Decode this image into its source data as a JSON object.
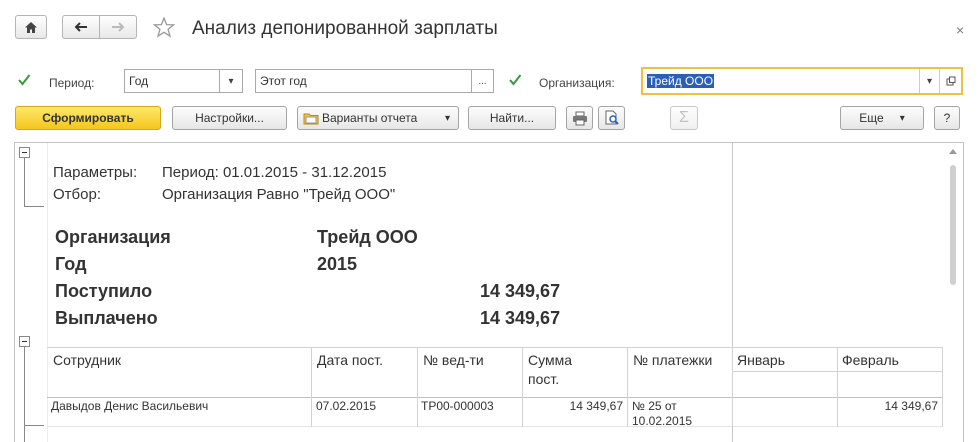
{
  "title": "Анализ депонированной зарплаты",
  "params": {
    "period_label": "Период:",
    "period_value": "Год",
    "period_range": "Этот год",
    "org_label": "Организация:",
    "org_value": "Трейд ООО"
  },
  "toolbar": {
    "generate": "Сформировать",
    "settings": "Настройки...",
    "variants": "Варианты отчета",
    "find": "Найти...",
    "more": "Еще",
    "help": "?"
  },
  "report": {
    "params_label": "Параметры:",
    "params_value": "Период: 01.01.2015 - 31.12.2015",
    "filter_label": "Отбор:",
    "filter_value": "Организация Равно \"Трейд ООО\"",
    "summary": {
      "org_label": "Организация",
      "org_value": "Трейд ООО",
      "year_label": "Год",
      "year_value": "2015",
      "received_label": "Поступило",
      "received_value": "14 349,67",
      "paid_label": "Выплачено",
      "paid_value": "14 349,67"
    },
    "columns": {
      "employee": "Сотрудник",
      "date": "Дата пост.",
      "sheet": "№ вед-ти",
      "sum_line1": "Сумма",
      "sum_line2": "пост.",
      "payment": "№ платежки",
      "jan": "Январь",
      "feb": "Февраль"
    },
    "row": {
      "employee": "Давыдов Денис Васильевич",
      "date": "07.02.2015",
      "sheet": "ТР00-000003",
      "sum": "14 349,67",
      "payment_line1": "№ 25 от",
      "payment_line2": "10.02.2015",
      "jan": "",
      "feb": "14 349,67"
    }
  },
  "colors": {
    "check_green": "#3a9a3a",
    "primary_yellow": "#f5c61d",
    "focus_border": "#f0c040",
    "selection_blue": "#2a5fb8"
  }
}
